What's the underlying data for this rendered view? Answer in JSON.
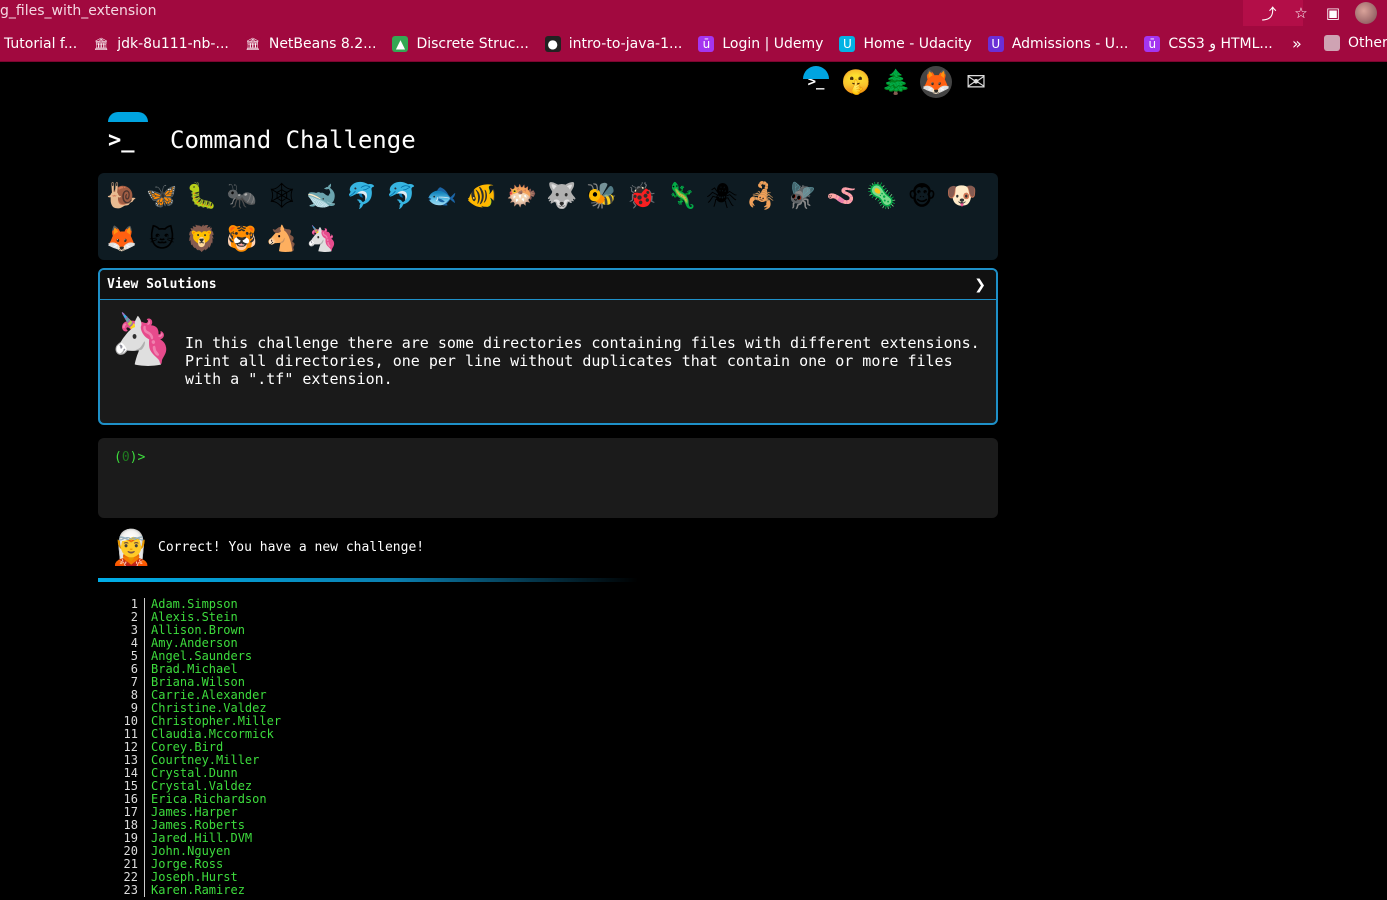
{
  "browser": {
    "tab_title": "g_files_with_extension",
    "icons": {
      "share": "share-icon",
      "star": "star-icon",
      "sidebar": "sidebar-icon"
    },
    "bookmarks": [
      {
        "label": "Tutorial f...",
        "icon": "page-icon",
        "color": "#a1093f"
      },
      {
        "label": "jdk-8u111-nb-...",
        "icon": "museum-icon",
        "color": "#a1093f"
      },
      {
        "label": "NetBeans 8.2...",
        "icon": "museum-icon",
        "color": "#a1093f"
      },
      {
        "label": "Discrete Struc...",
        "icon": "drive-icon",
        "color": "#34a853"
      },
      {
        "label": "intro-to-java-1...",
        "icon": "github-icon",
        "color": "#222222"
      },
      {
        "label": "Login | Udemy",
        "icon": "udemy-icon",
        "color": "#a435f0"
      },
      {
        "label": "Home - Udacity",
        "icon": "udacity-icon",
        "color": "#02b3e4"
      },
      {
        "label": "Admissions - U...",
        "icon": "udacity-icon",
        "color": "#6a2fd6"
      },
      {
        "label": "CSS3 و HTML...",
        "icon": "udemy-icon",
        "color": "#a435f0"
      }
    ],
    "more_label": "»",
    "other_bookmarks_label": "Other"
  },
  "header": {
    "icons": [
      "terminal-icon",
      "shush-emoji-icon",
      "tree-icon",
      "gitlab-icon",
      "mail-icon"
    ]
  },
  "page": {
    "title": "Command Challenge"
  },
  "animals": [
    {
      "name": "snail",
      "glyph": "🐌"
    },
    {
      "name": "butterfly",
      "glyph": "🦋"
    },
    {
      "name": "caterpillar",
      "glyph": "🐛"
    },
    {
      "name": "ant",
      "glyph": "🐜"
    },
    {
      "name": "web",
      "glyph": "🕸"
    },
    {
      "name": "whale",
      "glyph": "🐋"
    },
    {
      "name": "dolphin",
      "glyph": "🐬"
    },
    {
      "name": "shark",
      "glyph": "🐬"
    },
    {
      "name": "fish",
      "glyph": "🐟"
    },
    {
      "name": "tropical-fish",
      "glyph": "🐠"
    },
    {
      "name": "blowfish",
      "glyph": "🐡"
    },
    {
      "name": "wolf",
      "glyph": "🐺"
    },
    {
      "name": "bee",
      "glyph": "🐝"
    },
    {
      "name": "ladybug",
      "glyph": "🐞"
    },
    {
      "name": "lizard",
      "glyph": "🦎"
    },
    {
      "name": "spider",
      "glyph": "🕷"
    },
    {
      "name": "scorpion",
      "glyph": "🦂"
    },
    {
      "name": "fly",
      "glyph": "🪰"
    },
    {
      "name": "worm",
      "glyph": "🪱"
    },
    {
      "name": "microbe",
      "glyph": "🦠"
    },
    {
      "name": "monkey",
      "glyph": "🐵"
    },
    {
      "name": "dog",
      "glyph": "🐶"
    },
    {
      "name": "fox",
      "glyph": "🦊"
    },
    {
      "name": "cat",
      "glyph": "🐱"
    },
    {
      "name": "lion",
      "glyph": "🦁"
    },
    {
      "name": "tiger",
      "glyph": "🐯"
    },
    {
      "name": "horse",
      "glyph": "🐴"
    },
    {
      "name": "unicorn",
      "glyph": "🦄"
    }
  ],
  "solutions": {
    "header_label": "View Solutions",
    "chevron": "❯",
    "avatar_glyph": "🦄",
    "description": "In this challenge there are some directories containing files with different extensions. Print all directories, one per line without duplicates that contain one or more files with a \".tf\" extension."
  },
  "terminal": {
    "prompt_open": "(",
    "prompt_code": "0",
    "prompt_close": ")>"
  },
  "feedback": {
    "avatar_glyph": "🧝",
    "message": "Correct! You have a new challenge!"
  },
  "output": [
    {
      "n": "1",
      "v": "Adam.Simpson"
    },
    {
      "n": "2",
      "v": "Alexis.Stein"
    },
    {
      "n": "3",
      "v": "Allison.Brown"
    },
    {
      "n": "4",
      "v": "Amy.Anderson"
    },
    {
      "n": "5",
      "v": "Angel.Saunders"
    },
    {
      "n": "6",
      "v": "Brad.Michael"
    },
    {
      "n": "7",
      "v": "Briana.Wilson"
    },
    {
      "n": "8",
      "v": "Carrie.Alexander"
    },
    {
      "n": "9",
      "v": "Christine.Valdez"
    },
    {
      "n": "10",
      "v": "Christopher.Miller"
    },
    {
      "n": "11",
      "v": "Claudia.Mccormick"
    },
    {
      "n": "12",
      "v": "Corey.Bird"
    },
    {
      "n": "13",
      "v": "Courtney.Miller"
    },
    {
      "n": "14",
      "v": "Crystal.Dunn"
    },
    {
      "n": "15",
      "v": "Crystal.Valdez"
    },
    {
      "n": "16",
      "v": "Erica.Richardson"
    },
    {
      "n": "17",
      "v": "James.Harper"
    },
    {
      "n": "18",
      "v": "James.Roberts"
    },
    {
      "n": "19",
      "v": "Jared.Hill.DVM"
    },
    {
      "n": "20",
      "v": "John.Nguyen"
    },
    {
      "n": "21",
      "v": "Jorge.Ross"
    },
    {
      "n": "22",
      "v": "Joseph.Hurst"
    },
    {
      "n": "23",
      "v": "Karen.Ramirez"
    }
  ]
}
